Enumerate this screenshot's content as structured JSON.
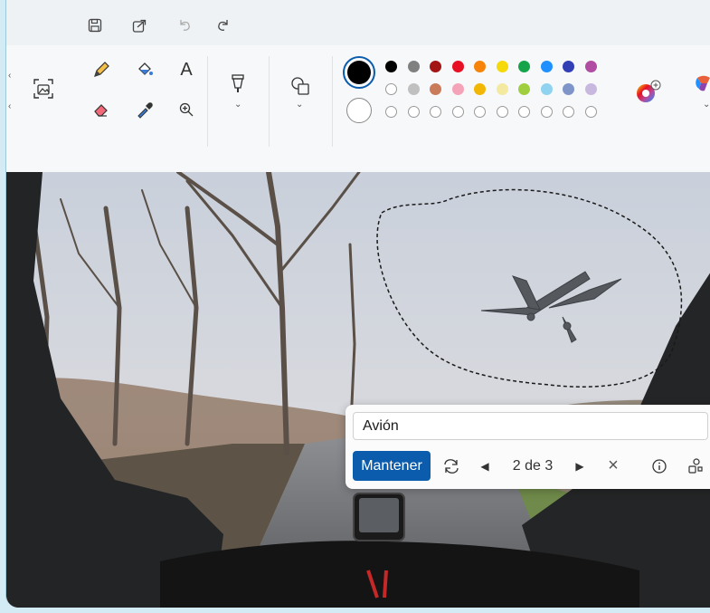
{
  "colors": {
    "row1": [
      "#000000",
      "#808080",
      "#a31515",
      "#e81123",
      "#f7830a",
      "#f5d90a",
      "#16a34a",
      "#1e90ff",
      "#3340b5",
      "#b04da3"
    ],
    "row2": [
      "#ffffff",
      "#c0c0c0",
      "#c97b5a",
      "#f5a3b8",
      "#f2b705",
      "#f3e9a0",
      "#9fcf3f",
      "#8fd3f0",
      "#7f95c9",
      "#c8b8e0"
    ],
    "primary": "#000000",
    "secondary": "#ffffff",
    "accent": "#0b5cad"
  },
  "icons": {
    "save": "save-icon",
    "share": "share-icon",
    "undo": "undo-icon",
    "redo": "redo-icon",
    "select": "image-select-icon",
    "pencil": "pencil-icon",
    "fill": "fill-bucket-icon",
    "text": "text-icon",
    "eraser": "eraser-icon",
    "picker": "color-picker-icon",
    "zoom": "magnifier-icon",
    "brush": "brush-icon",
    "shapes": "shapes-icon",
    "edit_colors": "edit-colors-icon",
    "copilot": "copilot-icon"
  },
  "toolbar": {
    "text_tool": "A"
  },
  "popup": {
    "label_value": "Avión",
    "keep_label": "Mantener",
    "counter": "2 de 3"
  }
}
